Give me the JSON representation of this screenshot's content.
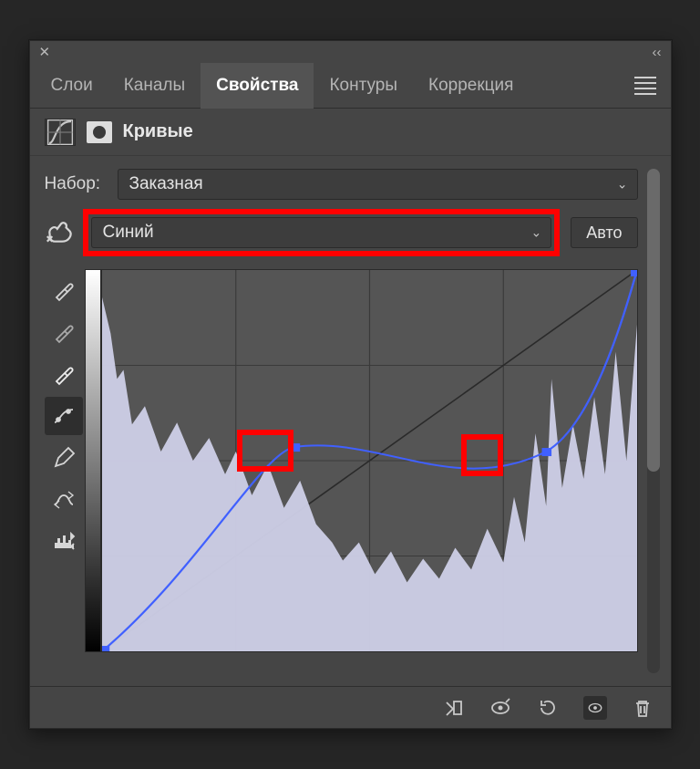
{
  "header": {},
  "tabs": [
    "Слои",
    "Каналы",
    "Свойства",
    "Контуры",
    "Коррекция"
  ],
  "tabs_active_index": 2,
  "title": "Кривые",
  "preset": {
    "label": "Набор:",
    "value": "Заказная"
  },
  "channel": {
    "value": "Синий"
  },
  "auto_label": "Авто",
  "tool_column": [
    "eyedropper-black",
    "eyedropper-gray",
    "eyedropper-white",
    "curve-point",
    "pencil",
    "smooth",
    "histogram-clip"
  ],
  "tool_active_index": 3,
  "curve": {
    "points": [
      {
        "x": 0,
        "y": 0
      },
      {
        "x": 0.36,
        "y": 0.54
      },
      {
        "x": 0.83,
        "y": 0.52
      },
      {
        "x": 1.0,
        "y": 1.0
      }
    ],
    "channel_color": "#4060ff"
  },
  "highlight_markers": [
    {
      "near_point_index": 1
    },
    {
      "near_point_index": 2
    }
  ],
  "footer_icons": [
    "clip-to-layer",
    "toggle-previous",
    "reset",
    "visibility",
    "delete"
  ],
  "footer_active_index": 3
}
